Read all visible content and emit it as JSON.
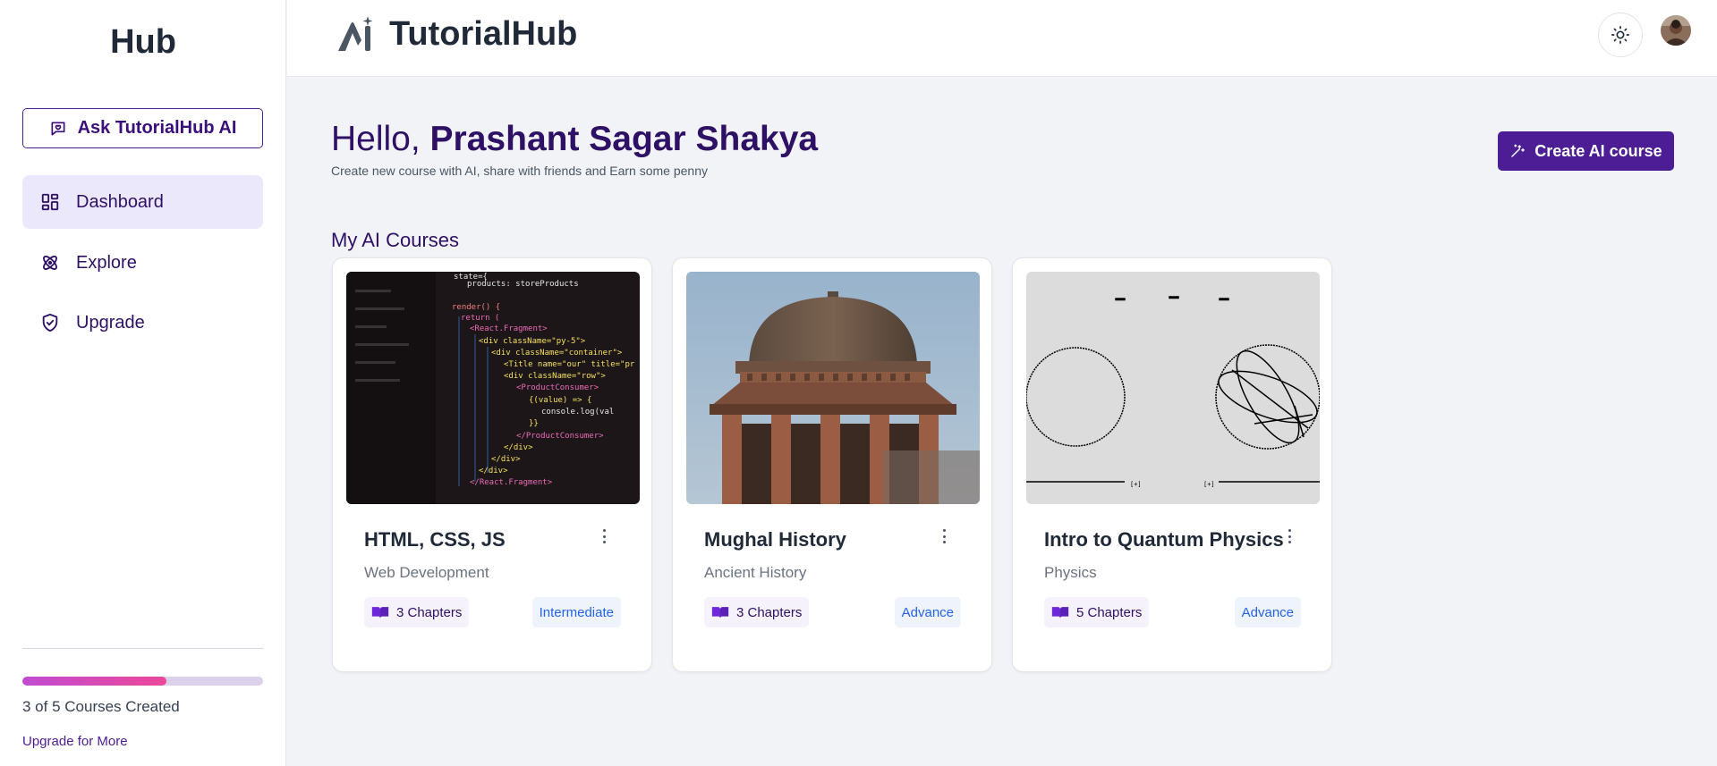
{
  "sidebar": {
    "brand": "Hub",
    "ask_button": "Ask TutorialHub AI",
    "nav": [
      {
        "label": "Dashboard",
        "icon": "grid-icon",
        "active": true
      },
      {
        "label": "Explore",
        "icon": "atom-icon",
        "active": false
      },
      {
        "label": "Upgrade",
        "icon": "shield-check-icon",
        "active": false
      }
    ],
    "progress": {
      "created": 3,
      "limit": 5,
      "fraction": 0.6,
      "label": "3 of 5 Courses Created"
    },
    "upgrade_link": "Upgrade for More"
  },
  "header": {
    "logo_text": "TutorialHub",
    "theme_icon": "sun-icon",
    "avatar": "user-avatar"
  },
  "main": {
    "greeting_prefix": "Hello, ",
    "user_name": "Prashant Sagar Shakya",
    "subtitle": "Create new course with AI, share with friends and Earn some penny",
    "create_button": "Create AI course",
    "section_title": "My AI Courses",
    "courses": [
      {
        "title": "HTML, CSS, JS",
        "category": "Web Development",
        "chapters": "3 Chapters",
        "level": "Intermediate",
        "image": "code-editor-photo"
      },
      {
        "title": "Mughal History",
        "category": "Ancient History",
        "chapters": "3 Chapters",
        "level": "Advance",
        "image": "mughal-dome-photo"
      },
      {
        "title": "Intro to Quantum Physics",
        "category": "Physics",
        "chapters": "5 Chapters",
        "level": "Advance",
        "image": "bloch-sphere-diagram"
      }
    ]
  },
  "colors": {
    "primary": "#4c1d95",
    "accent_pink": "#ec4899",
    "level_blue": "#2563eb",
    "background": "#f2f3f6"
  }
}
